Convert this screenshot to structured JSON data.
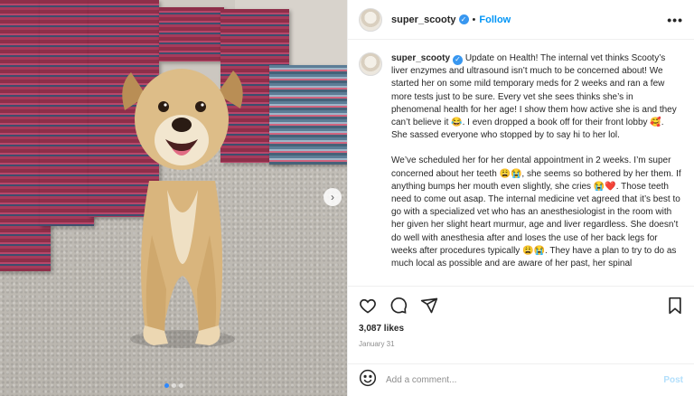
{
  "header": {
    "username": "super_scooty",
    "separator": "•",
    "follow_label": "Follow",
    "more_label": "•••"
  },
  "caption": {
    "username": "super_scooty",
    "paragraph1": "Update on Health! The internal vet thinks Scooty’s liver enzymes and ultrasound isn’t much to be concerned about! We started her on some mild temporary meds for 2 weeks and ran a few more tests just to be sure. Every vet she sees thinks she’s in phenomenal health for her age! I show them how active she is and they can’t believe it 😂. I even dropped a book off for their front lobby 🥰. She sassed everyone who stopped by to say hi to her lol.",
    "paragraph2": "We’ve scheduled her for her dental appointment in 2 weeks. I’m super concerned about her teeth 😩😭, she seems so bothered by her them. If anything bumps her mouth even slightly, she cries 😭❤️. Those teeth need to come out asap. The internal medicine vet agreed that it’s best to go with a specialized vet who has an anesthesiologist in the room with her given her slight heart murmur, age and liver regardless. She doesn’t do well with anesthesia after and loses the use of her back legs for weeks after procedures typically 😩😭. They have a plan to try to do as much local as possible and are aware of her past, her spinal"
  },
  "photo": {
    "next_label": "›",
    "slide_count": 3,
    "active_slide": 1
  },
  "engagement": {
    "likes": "3,087 likes",
    "date": "January 31"
  },
  "comment": {
    "placeholder": "Add a comment...",
    "post_label": "Post"
  },
  "icons": [
    "heart-icon",
    "comment-icon",
    "share-icon",
    "bookmark-icon",
    "emoji-icon",
    "verified-icon"
  ]
}
